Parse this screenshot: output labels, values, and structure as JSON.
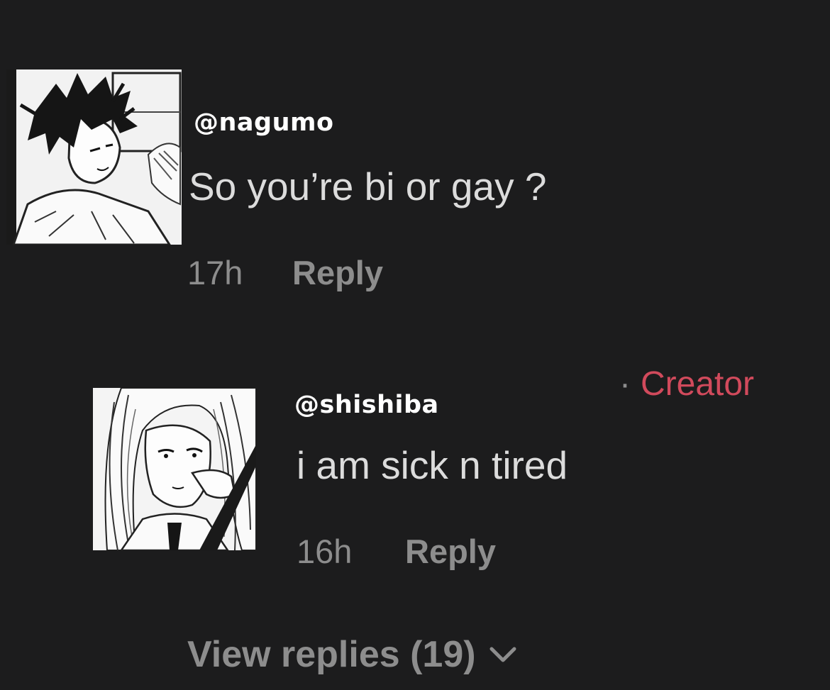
{
  "comments": [
    {
      "username": "@nagumo",
      "text": "So you’re bi or gay ?",
      "time": "17h",
      "reply_label": "Reply"
    },
    {
      "username": "@shishiba",
      "badge_separator": "·",
      "badge": "Creator",
      "text": "i am sick n tired",
      "time": "16h",
      "reply_label": "Reply"
    }
  ],
  "view_replies": {
    "label": "View replies (19)",
    "icon": "chevron-down-icon"
  },
  "colors": {
    "background": "#1c1c1d",
    "username": "#ffffff",
    "text": "#dcdcdc",
    "meta": "#8d8d8d",
    "creator": "#d14a5c"
  }
}
